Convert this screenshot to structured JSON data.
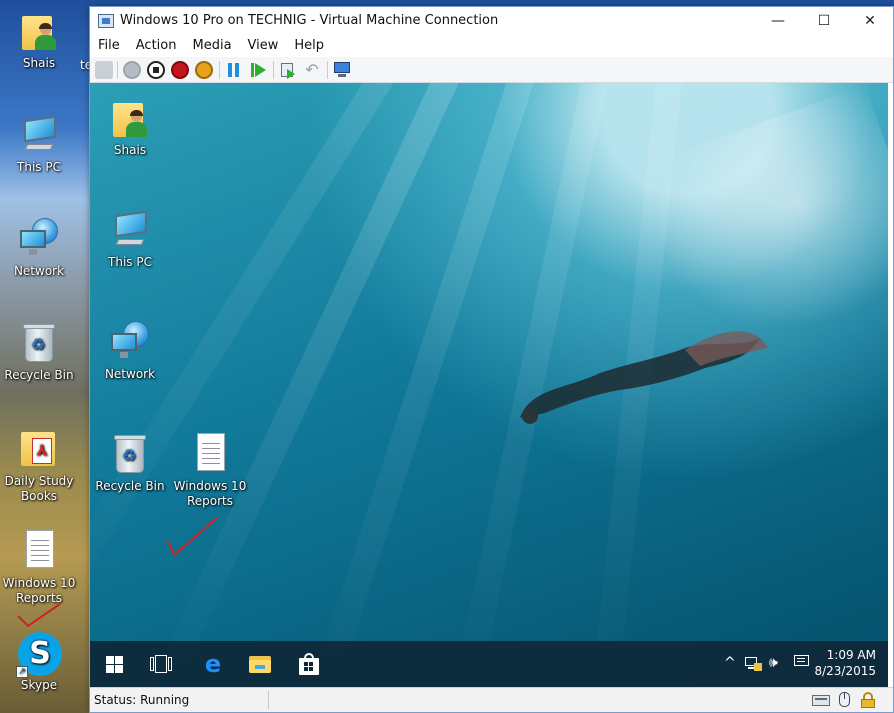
{
  "host": {
    "icons": [
      {
        "label": "Shais",
        "icon": "user-folder-icon"
      },
      {
        "label": "This PC",
        "icon": "computer-icon"
      },
      {
        "label": "Network",
        "icon": "network-icon"
      },
      {
        "label": "Recycle Bin",
        "icon": "recycle-bin-icon"
      },
      {
        "label": "Daily Study Books",
        "icon": "pdf-folder-icon"
      },
      {
        "label": "Windows 10 Reports",
        "icon": "document-icon"
      },
      {
        "label": "Skype",
        "icon": "skype-icon"
      }
    ],
    "partial_label": "te"
  },
  "window": {
    "title": "Windows 10 Pro on TECHNIG - Virtual Machine Connection",
    "controls": {
      "minimize": "—",
      "maximize": "☐",
      "close": "✕"
    }
  },
  "menu": [
    "File",
    "Action",
    "Media",
    "View",
    "Help"
  ],
  "toolbar": [
    "ctrl-alt-del-icon",
    "start-icon",
    "turn-off-icon",
    "shut-down-icon",
    "save-icon",
    "pause-icon",
    "reset-icon",
    "checkpoint-icon",
    "revert-icon",
    "enhanced-session-icon"
  ],
  "guest": {
    "icons": [
      {
        "label": "Shais",
        "icon": "user-folder-icon"
      },
      {
        "label": "This PC",
        "icon": "computer-icon"
      },
      {
        "label": "Network",
        "icon": "network-icon"
      },
      {
        "label": "Recycle Bin",
        "icon": "recycle-bin-icon"
      },
      {
        "label": "Windows 10 Reports",
        "icon": "document-icon"
      }
    ],
    "taskbar": {
      "pinned": [
        "start-icon",
        "task-view-icon",
        "edge-icon",
        "file-explorer-icon",
        "store-icon"
      ],
      "tray": [
        "show-hidden-icons-icon",
        "network-tray-icon",
        "volume-icon",
        "action-center-icon"
      ],
      "time": "1:09 AM",
      "date": "8/23/2015"
    }
  },
  "status": {
    "text": "Status: Running",
    "icons": [
      "keyboard-icon",
      "mouse-capture-icon",
      "lock-icon"
    ]
  },
  "colors": {
    "check_mark": "#d42020",
    "accent_green": "#2fae2f",
    "accent_blue": "#1f8fff"
  }
}
